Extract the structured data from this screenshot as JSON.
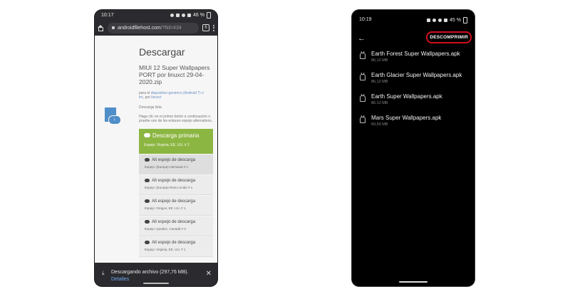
{
  "left": {
    "status_time": "10:17",
    "battery": "46 %",
    "url_host": "androidfilehost.com",
    "url_rest": "/?fid=434",
    "tab_count": "6",
    "page_title": "Descargar",
    "file_name": "MIUI 12 Super Wallpapers PORT por linuxct 29-04-2020.zip",
    "for_prefix": "para el ",
    "for_link": "dispositivo genérico (Android 7) o",
    "by_prefix": "tro",
    "by_text": ", por ",
    "by_link": "linuxct",
    "download_ready": "Descarga lista",
    "instructions": "Haga clic en el primer botón a continuación o pruebe uno de los enlaces espejo alternativos.",
    "primary_label": "Descarga primaria",
    "primary_sub": "Espejo: Virginia, EE. UU. # 2",
    "mirror_label": "Alt espejo de descarga",
    "mirrors": [
      "Espejo: (Europa) Alemania # 1",
      "Espejo: (Europa) Reino Unido # 1",
      "Espejo: Oregon, EE. UU. # 1",
      "Espejo: Quebec, Canadá # 3",
      "Espejo: Virginia, EE. UU. # 1"
    ],
    "dl_text": "Descargando archivo (297,76 MB).",
    "dl_link": "Detalles"
  },
  "right": {
    "status_time": "10:19",
    "battery": "45 %",
    "action": "DESCOMPRIMIR",
    "files": [
      {
        "name": "Earth Forest Super Wallpapers.apk",
        "size": "86,12 MB"
      },
      {
        "name": "Earth Glacier Super Wallpapers.apk",
        "size": "86,12 MB"
      },
      {
        "name": "Earth Super Wallpapers.apk",
        "size": "86,12 MB"
      },
      {
        "name": "Mars Super Wallpapers.apk",
        "size": "69,50 MB"
      }
    ]
  },
  "colors": {
    "primary_green": "#8cb642",
    "link_blue": "#6fa6e8",
    "highlight_red": "#d0101c"
  }
}
